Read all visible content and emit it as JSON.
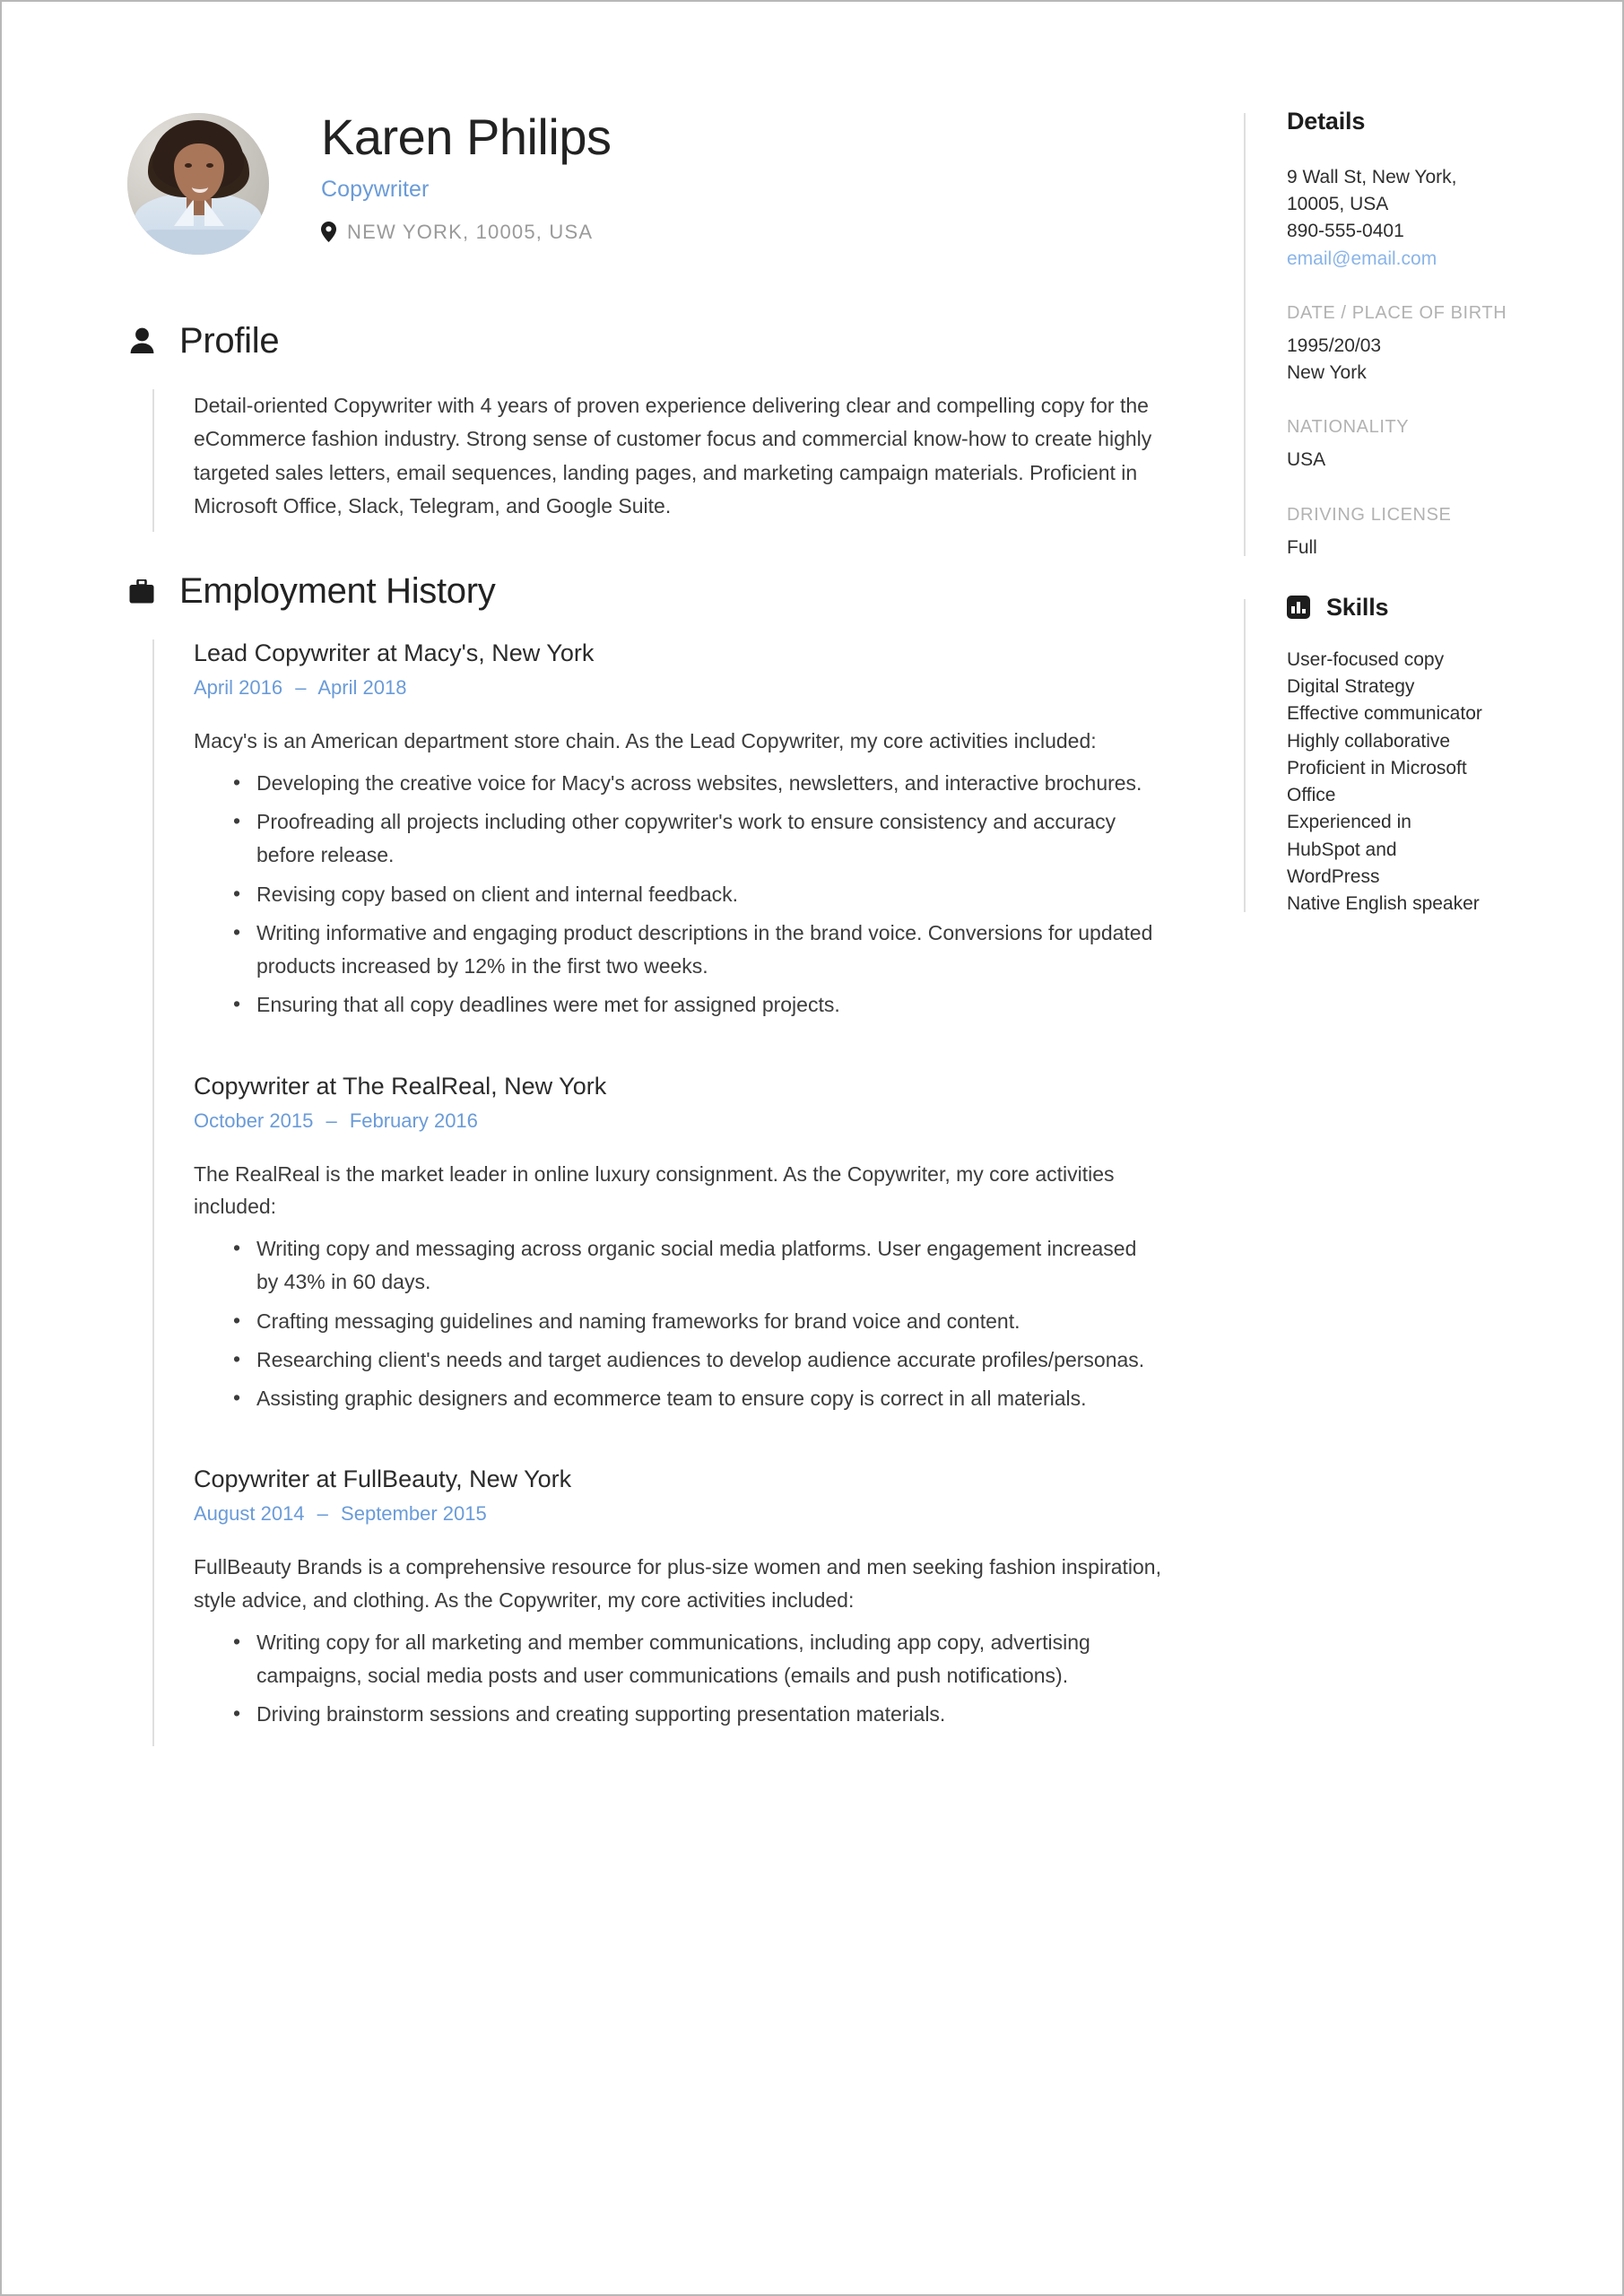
{
  "header": {
    "full_name": "Karen Philips",
    "job_title": "Copywriter",
    "location": "NEW YORK, 10005, USA",
    "location_icon": "map-pin-icon",
    "avatar_alt": "portrait photo of Karen Philips"
  },
  "accent_color": "#6a9bd8",
  "sections": {
    "profile": {
      "icon": "person-icon",
      "title": "Profile",
      "text": "Detail-oriented Copywriter with 4 years of proven experience delivering clear and compelling copy for the eCommerce fashion industry. Strong sense of customer focus and commercial know-how to create highly targeted sales letters, email sequences, landing pages, and marketing campaign materials. Proficient in Microsoft Office, Slack, Telegram, and Google Suite."
    },
    "employment": {
      "icon": "briefcase-icon",
      "title": "Employment History",
      "jobs": [
        {
          "heading": "Lead Copywriter at Macy's, New York",
          "start_date": "April 2016",
          "end_date": "April 2018",
          "dash": "–",
          "description": "Macy's is an American department store chain. As the Lead Copywriter, my core activities included:",
          "bullets": [
            "Developing the creative voice for Macy's across websites, newsletters, and interactive brochures.",
            "Proofreading all projects including other copywriter's work to ensure consistency and accuracy before release.",
            "Revising copy based on client and internal feedback.",
            "Writing informative and engaging product descriptions in the brand voice. Conversions for updated products increased by 12% in the first two weeks.",
            "Ensuring that all copy deadlines were met for assigned projects."
          ]
        },
        {
          "heading": "Copywriter at The RealReal, New York",
          "start_date": "October 2015",
          "end_date": "February 2016",
          "dash": "–",
          "description": "The RealReal is the market leader in online luxury consignment. As the Copywriter, my core activities included:",
          "bullets": [
            "Writing copy and messaging across organic social media platforms. User engagement increased by 43% in 60 days.",
            "Crafting messaging guidelines and naming frameworks for brand voice and content.",
            "Researching client's needs and target audiences to develop audience accurate profiles/personas.",
            "Assisting graphic designers and ecommerce team to ensure copy is correct in all materials."
          ]
        },
        {
          "heading": "Copywriter at FullBeauty, New York",
          "start_date": "August 2014",
          "end_date": "September 2015",
          "dash": "–",
          "description": "FullBeauty Brands is a comprehensive resource for plus-size women and men seeking fashion inspiration, style advice, and clothing. As the Copywriter, my core activities included:",
          "bullets": [
            "Writing copy for all marketing and member communications, including app copy, advertising campaigns, social media posts and user communications (emails and push notifications).",
            "Driving brainstorm sessions and creating supporting presentation materials."
          ]
        }
      ]
    }
  },
  "sidebar": {
    "details": {
      "title": "Details",
      "address_line1": "9 Wall St, New York,",
      "address_line2": "10005, USA",
      "phone": "890-555-0401",
      "email": "email@email.com",
      "dob_label": "DATE / PLACE OF BIRTH",
      "dob_date": "1995/20/03",
      "dob_place": "New York",
      "nationality_label": "NATIONALITY",
      "nationality_value": "USA",
      "license_label": "DRIVING LICENSE",
      "license_value": "Full"
    },
    "skills": {
      "icon": "bar-chart-icon",
      "title": "Skills",
      "items": [
        "User-focused copy",
        "Digital Strategy",
        "Effective communicator",
        "Highly collaborative",
        "Proficient in Microsoft",
        "Office",
        "Experienced in",
        "HubSpot and",
        "WordPress",
        "Native English speaker"
      ]
    }
  }
}
